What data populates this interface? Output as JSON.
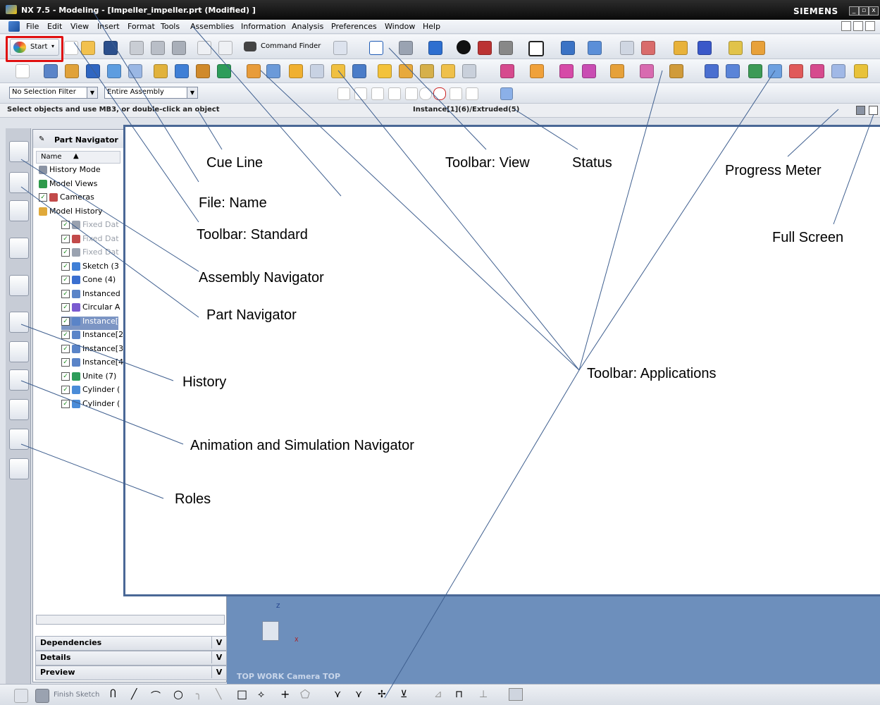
{
  "window": {
    "title": "NX 7.5 - Modeling - [Impeller_impeller.prt (Modified) ]",
    "brand": "SIEMENS",
    "controls": [
      "_",
      "▫",
      "x"
    ]
  },
  "menu": [
    "File",
    "Edit",
    "View",
    "Insert",
    "Format",
    "Tools",
    "Assemblies",
    "Information",
    "Analysis",
    "Preferences",
    "Window",
    "Help"
  ],
  "standard_toolbar": {
    "start_label": "Start",
    "command_finder": "Command Finder"
  },
  "selection_bar": {
    "filter": "No Selection Filter",
    "scope": "Entire Assembly"
  },
  "cue_line": "Select objects and use MB3, or double-click an object",
  "status_line": "Instance[1](6)/Extruded(5)",
  "navigator": {
    "title": "Part Navigator",
    "column": "Name",
    "rows": [
      {
        "label": "History Mode",
        "indent": 0,
        "check": false
      },
      {
        "label": "Model Views",
        "indent": 0,
        "check": false
      },
      {
        "label": "Cameras",
        "indent": 0,
        "check": true
      },
      {
        "label": "Model History",
        "indent": 0,
        "check": false
      },
      {
        "label": "Fixed Dat",
        "indent": 1,
        "check": true
      },
      {
        "label": "Fixed Dat",
        "indent": 1,
        "check": true
      },
      {
        "label": "Fixed Dat",
        "indent": 1,
        "check": true
      },
      {
        "label": "Sketch (3",
        "indent": 1,
        "check": true
      },
      {
        "label": "Cone (4)",
        "indent": 1,
        "check": true
      },
      {
        "label": "Instanced",
        "indent": 1,
        "check": true
      },
      {
        "label": "Circular A",
        "indent": 1,
        "check": true
      },
      {
        "label": "Instance[",
        "indent": 1,
        "check": true
      },
      {
        "label": "Instance[2",
        "indent": 1,
        "check": true
      },
      {
        "label": "Instance[3",
        "indent": 1,
        "check": true
      },
      {
        "label": "Instance[4",
        "indent": 1,
        "check": true
      },
      {
        "label": "Unite (7)",
        "indent": 1,
        "check": true
      },
      {
        "label": "Cylinder (",
        "indent": 1,
        "check": true
      },
      {
        "label": "Cylinder (",
        "indent": 1,
        "check": true
      }
    ],
    "panels": [
      "Dependencies",
      "Details",
      "Preview"
    ]
  },
  "graphics": {
    "view_label": "TOP WORK Camera TOP",
    "axis_z": "Z",
    "axis_x": "X"
  },
  "bottom_toolbar": {
    "finish_sketch": "Finish Sketch"
  },
  "annotations": {
    "cue_line": "Cue Line",
    "file_name": "File: Name",
    "toolbar_standard": "Toolbar: Standard",
    "assembly_navigator": "Assembly Navigator",
    "part_navigator": "Part Navigator",
    "history": "History",
    "animation_nav": "Animation and Simulation Navigator",
    "roles": "Roles",
    "toolbar_view": "Toolbar: View",
    "status": "Status",
    "progress_meter": "Progress Meter",
    "full_screen": "Full Screen",
    "toolbar_applications": "Toolbar: Applications"
  },
  "colors": {
    "highlight_box": "#e01010",
    "overlay_border": "#4a6896",
    "graphics_bg": "#6d8fbc",
    "leader_line": "#3f5f8f"
  }
}
